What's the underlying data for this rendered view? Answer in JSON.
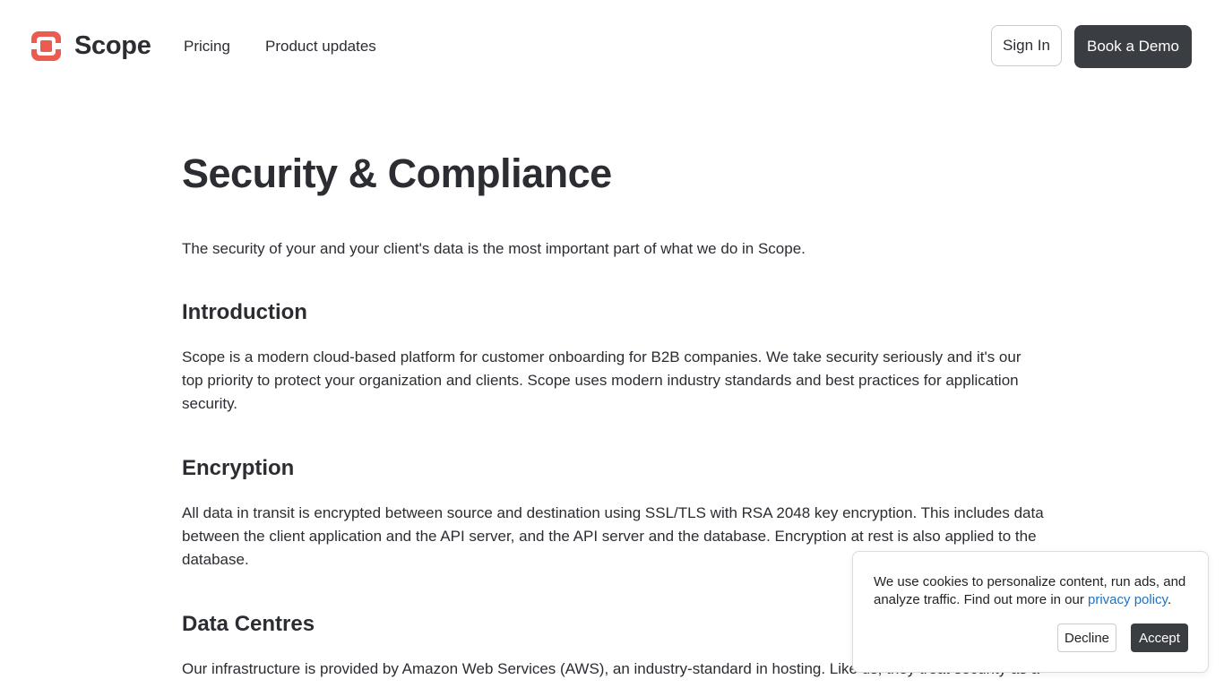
{
  "colors": {
    "brand": "#ec5b4f",
    "dark_button": "#3a3d42",
    "link": "#1a73c7"
  },
  "header": {
    "logo_text": "Scope",
    "nav": {
      "pricing": "Pricing",
      "product_updates": "Product updates"
    },
    "sign_in": "Sign In",
    "book_demo": "Book a Demo"
  },
  "main": {
    "title": "Security & Compliance",
    "lead": "The security of your and your client's data is the most important part of what we do in Scope.",
    "sections": [
      {
        "heading": "Introduction",
        "body": "Scope is a modern cloud-based platform for customer onboarding for B2B companies. We take security seriously and it's our top priority to protect your organization and clients. Scope uses modern industry standards and best practices for application security."
      },
      {
        "heading": "Encryption",
        "body": "All data in transit is encrypted between source and destination using SSL/TLS with RSA 2048 key encryption. This includes data between the client application and the API server, and the API server and the database. Encryption at rest is also applied to the database."
      },
      {
        "heading": "Data Centres",
        "body": "Our infrastructure is provided by Amazon Web Services (AWS), an industry-standard in hosting. Like us, they treat security as a"
      }
    ]
  },
  "cookie_banner": {
    "text_before_link": "We use cookies to personalize content, run ads, and analyze traffic. Find out more in our ",
    "link_text": "privacy policy",
    "text_after_link": ".",
    "decline": "Decline",
    "accept": "Accept"
  }
}
